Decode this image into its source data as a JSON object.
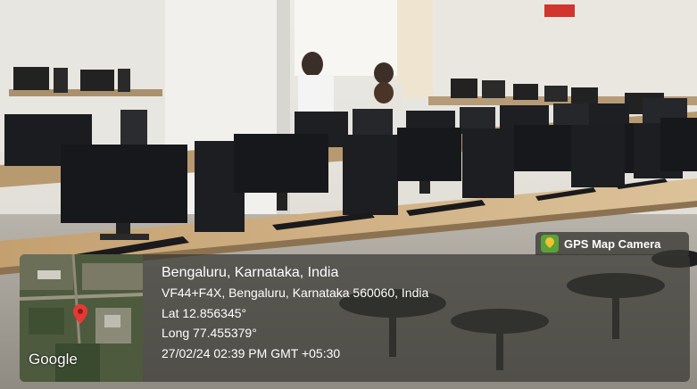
{
  "overlay": {
    "badge_label": "GPS Map Camera",
    "address_line_1": "Bengaluru, Karnataka, India",
    "address_line_2": "VF44+F4X, Bengaluru, Karnataka 560060, India",
    "latitude": "Lat 12.856345°",
    "longitude": "Long 77.455379°",
    "timestamp": "27/02/24 02:39 PM GMT +05:30",
    "map_brand": "Google"
  },
  "colors": {
    "wall": "#e9e6df",
    "desk": "#c9a978",
    "equipment": "#1c1d20",
    "marker": "#e53935"
  },
  "icons": [
    "gps-map-camera-icon",
    "location-pin-icon"
  ]
}
